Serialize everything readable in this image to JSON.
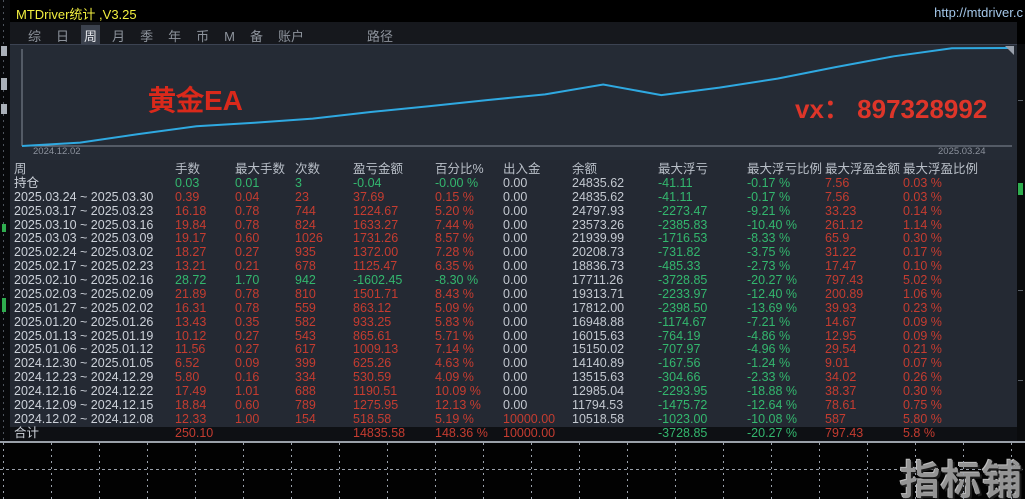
{
  "window": {
    "title": "MTDriver统计 ,V3.25",
    "url": "http://mtdriver.c"
  },
  "menu": {
    "items": [
      "综",
      "日",
      "周",
      "月",
      "季",
      "年",
      "币",
      "M",
      "备",
      "账户",
      "路径"
    ],
    "selected": "周"
  },
  "chart": {
    "strategy_label": "黄金EA",
    "contact": "vx： 897328992",
    "date_left": "2024.12.02",
    "date_right": "2025.03.24"
  },
  "chart_data": {
    "type": "line",
    "title": "黄金EA 余额曲线",
    "xlabel": "2024.12.02 ~ 2025.03.24",
    "ylabel": "余额",
    "x_tick_labels": [
      "2024.12.02",
      "2025.03.24"
    ],
    "legend": "none",
    "grid": false,
    "ylim": [
      10000,
      24836
    ],
    "line_color": "#2fa9e1",
    "series": [
      {
        "name": "余额",
        "values": [
          10000.0,
          10518.58,
          11794.53,
          12985.04,
          13515.63,
          14140.89,
          15150.02,
          16015.63,
          16948.88,
          17812.0,
          19313.71,
          17711.26,
          18836.73,
          20208.73,
          21939.99,
          23573.26,
          24797.93,
          24835.62
        ]
      }
    ]
  },
  "table": {
    "headers": [
      "周",
      "手数",
      "最大手数",
      "次数",
      "盈亏金额",
      "百分比%",
      "出入金",
      "余额",
      "最大浮亏",
      "最大浮亏比例",
      "最大浮盈金额",
      "最大浮盈比例"
    ],
    "position_row": {
      "period": "持仓",
      "lots": "0.03",
      "max_lots": "0.01",
      "count": "3",
      "pl": "-0.04",
      "pct": "-0.00 %",
      "in_out": "0.00",
      "balance": "24835.62",
      "max_float_loss": "-41.11",
      "max_float_loss_pct": "-0.17 %",
      "max_float_profit": "7.56",
      "max_float_profit_pct": "0.03 %",
      "sign": "neg"
    },
    "rows": [
      {
        "period": "2025.03.24 ~ 2025.03.30",
        "lots": "0.39",
        "max_lots": "0.04",
        "count": "23",
        "pl": "37.69",
        "pct": "0.15 %",
        "in_out": "0.00",
        "balance": "24835.62",
        "max_float_loss": "-41.11",
        "max_float_loss_pct": "-0.17 %",
        "max_float_profit": "7.56",
        "max_float_profit_pct": "0.03 %",
        "sign": "pos"
      },
      {
        "period": "2025.03.17 ~ 2025.03.23",
        "lots": "16.18",
        "max_lots": "0.78",
        "count": "744",
        "pl": "1224.67",
        "pct": "5.20 %",
        "in_out": "0.00",
        "balance": "24797.93",
        "max_float_loss": "-2273.47",
        "max_float_loss_pct": "-9.21 %",
        "max_float_profit": "33.23",
        "max_float_profit_pct": "0.14 %",
        "sign": "pos"
      },
      {
        "period": "2025.03.10 ~ 2025.03.16",
        "lots": "19.84",
        "max_lots": "0.78",
        "count": "824",
        "pl": "1633.27",
        "pct": "7.44 %",
        "in_out": "0.00",
        "balance": "23573.26",
        "max_float_loss": "-2385.83",
        "max_float_loss_pct": "-10.40 %",
        "max_float_profit": "261.12",
        "max_float_profit_pct": "1.14 %",
        "sign": "pos"
      },
      {
        "period": "2025.03.03 ~ 2025.03.09",
        "lots": "19.17",
        "max_lots": "0.60",
        "count": "1026",
        "pl": "1731.26",
        "pct": "8.57 %",
        "in_out": "0.00",
        "balance": "21939.99",
        "max_float_loss": "-1716.53",
        "max_float_loss_pct": "-8.33 %",
        "max_float_profit": "65.9",
        "max_float_profit_pct": "0.30 %",
        "sign": "pos"
      },
      {
        "period": "2025.02.24 ~ 2025.03.02",
        "lots": "18.27",
        "max_lots": "0.27",
        "count": "935",
        "pl": "1372.00",
        "pct": "7.28 %",
        "in_out": "0.00",
        "balance": "20208.73",
        "max_float_loss": "-731.82",
        "max_float_loss_pct": "-3.75 %",
        "max_float_profit": "31.22",
        "max_float_profit_pct": "0.17 %",
        "sign": "pos"
      },
      {
        "period": "2025.02.17 ~ 2025.02.23",
        "lots": "13.21",
        "max_lots": "0.21",
        "count": "678",
        "pl": "1125.47",
        "pct": "6.35 %",
        "in_out": "0.00",
        "balance": "18836.73",
        "max_float_loss": "-485.33",
        "max_float_loss_pct": "-2.73 %",
        "max_float_profit": "17.47",
        "max_float_profit_pct": "0.10 %",
        "sign": "pos"
      },
      {
        "period": "2025.02.10 ~ 2025.02.16",
        "lots": "28.72",
        "max_lots": "1.70",
        "count": "942",
        "pl": "-1602.45",
        "pct": "-8.30 %",
        "in_out": "0.00",
        "balance": "17711.26",
        "max_float_loss": "-3728.85",
        "max_float_loss_pct": "-20.27 %",
        "max_float_profit": "797.43",
        "max_float_profit_pct": "5.02 %",
        "sign": "neg"
      },
      {
        "period": "2025.02.03 ~ 2025.02.09",
        "lots": "21.89",
        "max_lots": "0.78",
        "count": "810",
        "pl": "1501.71",
        "pct": "8.43 %",
        "in_out": "0.00",
        "balance": "19313.71",
        "max_float_loss": "-2233.97",
        "max_float_loss_pct": "-12.40 %",
        "max_float_profit": "200.89",
        "max_float_profit_pct": "1.06 %",
        "sign": "pos"
      },
      {
        "period": "2025.01.27 ~ 2025.02.02",
        "lots": "16.31",
        "max_lots": "0.78",
        "count": "559",
        "pl": "863.12",
        "pct": "5.09 %",
        "in_out": "0.00",
        "balance": "17812.00",
        "max_float_loss": "-2398.50",
        "max_float_loss_pct": "-13.69 %",
        "max_float_profit": "39.93",
        "max_float_profit_pct": "0.23 %",
        "sign": "pos"
      },
      {
        "period": "2025.01.20 ~ 2025.01.26",
        "lots": "13.43",
        "max_lots": "0.35",
        "count": "582",
        "pl": "933.25",
        "pct": "5.83 %",
        "in_out": "0.00",
        "balance": "16948.88",
        "max_float_loss": "-1174.67",
        "max_float_loss_pct": "-7.21 %",
        "max_float_profit": "14.67",
        "max_float_profit_pct": "0.09 %",
        "sign": "pos"
      },
      {
        "period": "2025.01.13 ~ 2025.01.19",
        "lots": "10.12",
        "max_lots": "0.27",
        "count": "543",
        "pl": "865.61",
        "pct": "5.71 %",
        "in_out": "0.00",
        "balance": "16015.63",
        "max_float_loss": "-764.19",
        "max_float_loss_pct": "-4.86 %",
        "max_float_profit": "12.95",
        "max_float_profit_pct": "0.09 %",
        "sign": "pos"
      },
      {
        "period": "2025.01.06 ~ 2025.01.12",
        "lots": "11.56",
        "max_lots": "0.27",
        "count": "617",
        "pl": "1009.13",
        "pct": "7.14 %",
        "in_out": "0.00",
        "balance": "15150.02",
        "max_float_loss": "-707.97",
        "max_float_loss_pct": "-4.96 %",
        "max_float_profit": "29.54",
        "max_float_profit_pct": "0.21 %",
        "sign": "pos"
      },
      {
        "period": "2024.12.30 ~ 2025.01.05",
        "lots": "6.52",
        "max_lots": "0.09",
        "count": "399",
        "pl": "625.26",
        "pct": "4.63 %",
        "in_out": "0.00",
        "balance": "14140.89",
        "max_float_loss": "-167.56",
        "max_float_loss_pct": "-1.24 %",
        "max_float_profit": "9.01",
        "max_float_profit_pct": "0.07 %",
        "sign": "pos"
      },
      {
        "period": "2024.12.23 ~ 2024.12.29",
        "lots": "5.80",
        "max_lots": "0.16",
        "count": "334",
        "pl": "530.59",
        "pct": "4.09 %",
        "in_out": "0.00",
        "balance": "13515.63",
        "max_float_loss": "-304.66",
        "max_float_loss_pct": "-2.33 %",
        "max_float_profit": "34.02",
        "max_float_profit_pct": "0.26 %",
        "sign": "pos"
      },
      {
        "period": "2024.12.16 ~ 2024.12.22",
        "lots": "17.49",
        "max_lots": "1.01",
        "count": "688",
        "pl": "1190.51",
        "pct": "10.09 %",
        "in_out": "0.00",
        "balance": "12985.04",
        "max_float_loss": "-2293.95",
        "max_float_loss_pct": "-18.88 %",
        "max_float_profit": "38.37",
        "max_float_profit_pct": "0.30 %",
        "sign": "pos"
      },
      {
        "period": "2024.12.09 ~ 2024.12.15",
        "lots": "18.84",
        "max_lots": "0.60",
        "count": "789",
        "pl": "1275.95",
        "pct": "12.13 %",
        "in_out": "0.00",
        "balance": "11794.53",
        "max_float_loss": "-1475.72",
        "max_float_loss_pct": "-12.64 %",
        "max_float_profit": "78.61",
        "max_float_profit_pct": "0.75 %",
        "sign": "pos"
      },
      {
        "period": "2024.12.02 ~ 2024.12.08",
        "lots": "12.33",
        "max_lots": "1.00",
        "count": "154",
        "pl": "518.58",
        "pct": "5.19 %",
        "in_out": "10000.00",
        "balance": "10518.58",
        "max_float_loss": "-1023.00",
        "max_float_loss_pct": "-10.08 %",
        "max_float_profit": "587",
        "max_float_profit_pct": "5.80 %",
        "sign": "pos"
      }
    ],
    "total": {
      "period": "合计",
      "lots": "250.10",
      "max_lots": "",
      "count": "",
      "pl": "14835.58",
      "pct": "148.36 %",
      "in_out": "10000.00",
      "balance": "",
      "max_float_loss": "-3728.85",
      "max_float_loss_pct": "-20.27 %",
      "max_float_profit": "797.43",
      "max_float_profit_pct": "5.8 %",
      "sign": "pos"
    }
  },
  "watermark": "指标铺",
  "colors": {
    "profit_red": "#c53c30",
    "loss_green": "#33b76e",
    "title_yellow": "#f2ef3f",
    "equity_line_blue": "#2fa9e1",
    "annotation_red": "#da291b",
    "url_blue": "#a3c6e8"
  }
}
